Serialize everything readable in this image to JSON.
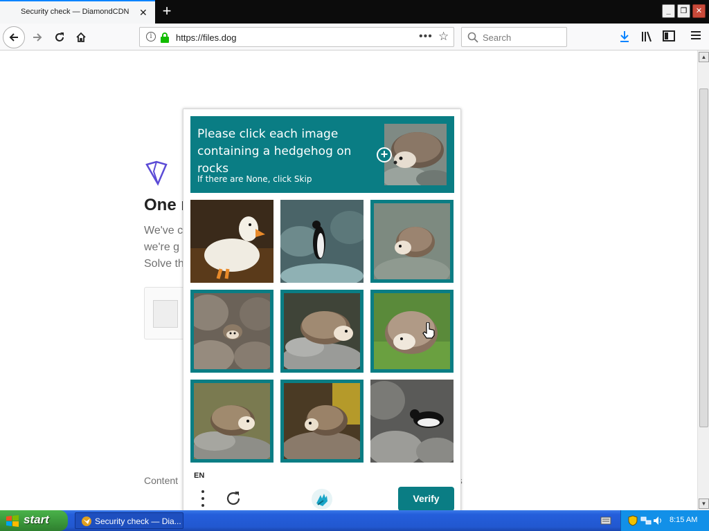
{
  "browser": {
    "tab_title": "Security check — DiamondCDN",
    "url": "https://files.dog",
    "search_placeholder": "Search",
    "new_tab_label": "+",
    "tab_close_label": "✕"
  },
  "page": {
    "heading": "One r",
    "lines": [
      "We've c",
      "we're g",
      "Solve th"
    ],
    "footer_left": "Content",
    "footer_right": "ess"
  },
  "captcha": {
    "prompt": "Please click each image containing a hedgehog on rocks",
    "subprompt": "If there are None, click Skip",
    "language": "EN",
    "verify_label": "Verify",
    "accent_color": "#0a7d84",
    "tiles": [
      {
        "subject": "duck",
        "selected": false
      },
      {
        "subject": "penguin",
        "selected": false
      },
      {
        "subject": "hedgehog",
        "selected": true
      },
      {
        "subject": "hedgehog",
        "selected": true
      },
      {
        "subject": "hedgehog",
        "selected": true
      },
      {
        "subject": "hedgehog",
        "selected": true
      },
      {
        "subject": "hedgehog",
        "selected": true
      },
      {
        "subject": "hedgehog",
        "selected": true
      },
      {
        "subject": "penguin",
        "selected": false
      }
    ]
  },
  "taskbar": {
    "start_label": "start",
    "task_label": "Security check — Dia...",
    "clock": "8:15 AM"
  },
  "icons": {
    "back": "arrow-left-icon",
    "forward": "arrow-right-icon",
    "reload": "reload-icon",
    "home": "home-icon",
    "lock": "lock-icon",
    "download": "download-icon",
    "library": "library-icon",
    "sidebar": "sidebar-icon",
    "menu": "hamburger-menu-icon"
  }
}
